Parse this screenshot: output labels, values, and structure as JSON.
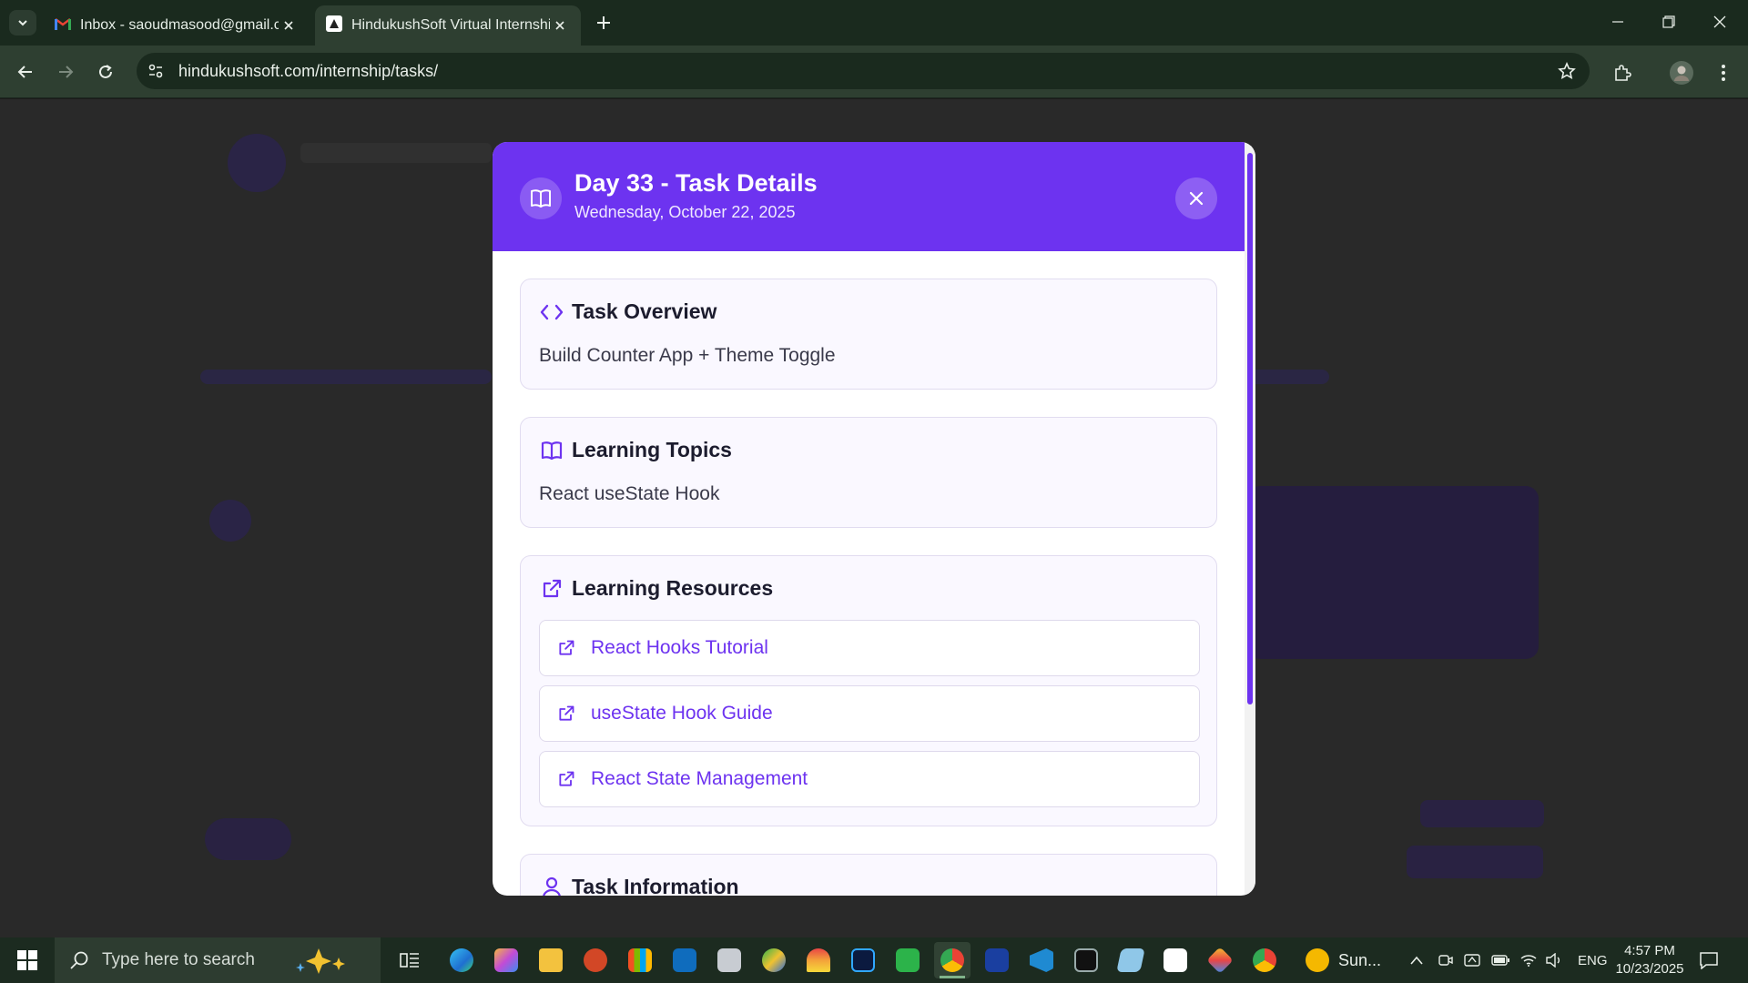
{
  "browser": {
    "tabs": [
      {
        "title": "Inbox - saoudmasood@gmail.com",
        "favicon": "gmail-icon"
      },
      {
        "title": "HindukushSoft Virtual Internship",
        "favicon": "hindukushsoft-icon"
      }
    ],
    "url": "hindukushsoft.com/internship/tasks/"
  },
  "modal": {
    "title": "Day 33 - Task Details",
    "date": "Wednesday, October 22, 2025",
    "sections": {
      "overview": {
        "title": "Task Overview",
        "text": "Build Counter App + Theme Toggle"
      },
      "topics": {
        "title": "Learning Topics",
        "text": "React useState Hook"
      },
      "resources": {
        "title": "Learning Resources",
        "links": [
          "React Hooks Tutorial",
          "useState Hook Guide",
          "React State Management"
        ]
      },
      "info": {
        "title": "Task Information"
      }
    }
  },
  "taskbar": {
    "search_placeholder": "Type here to search",
    "weather": "Sun...",
    "language": "ENG",
    "time": "4:57 PM",
    "date": "10/23/2025"
  },
  "colors": {
    "accent": "#6d33f0",
    "chrome": "#2e3f31"
  }
}
